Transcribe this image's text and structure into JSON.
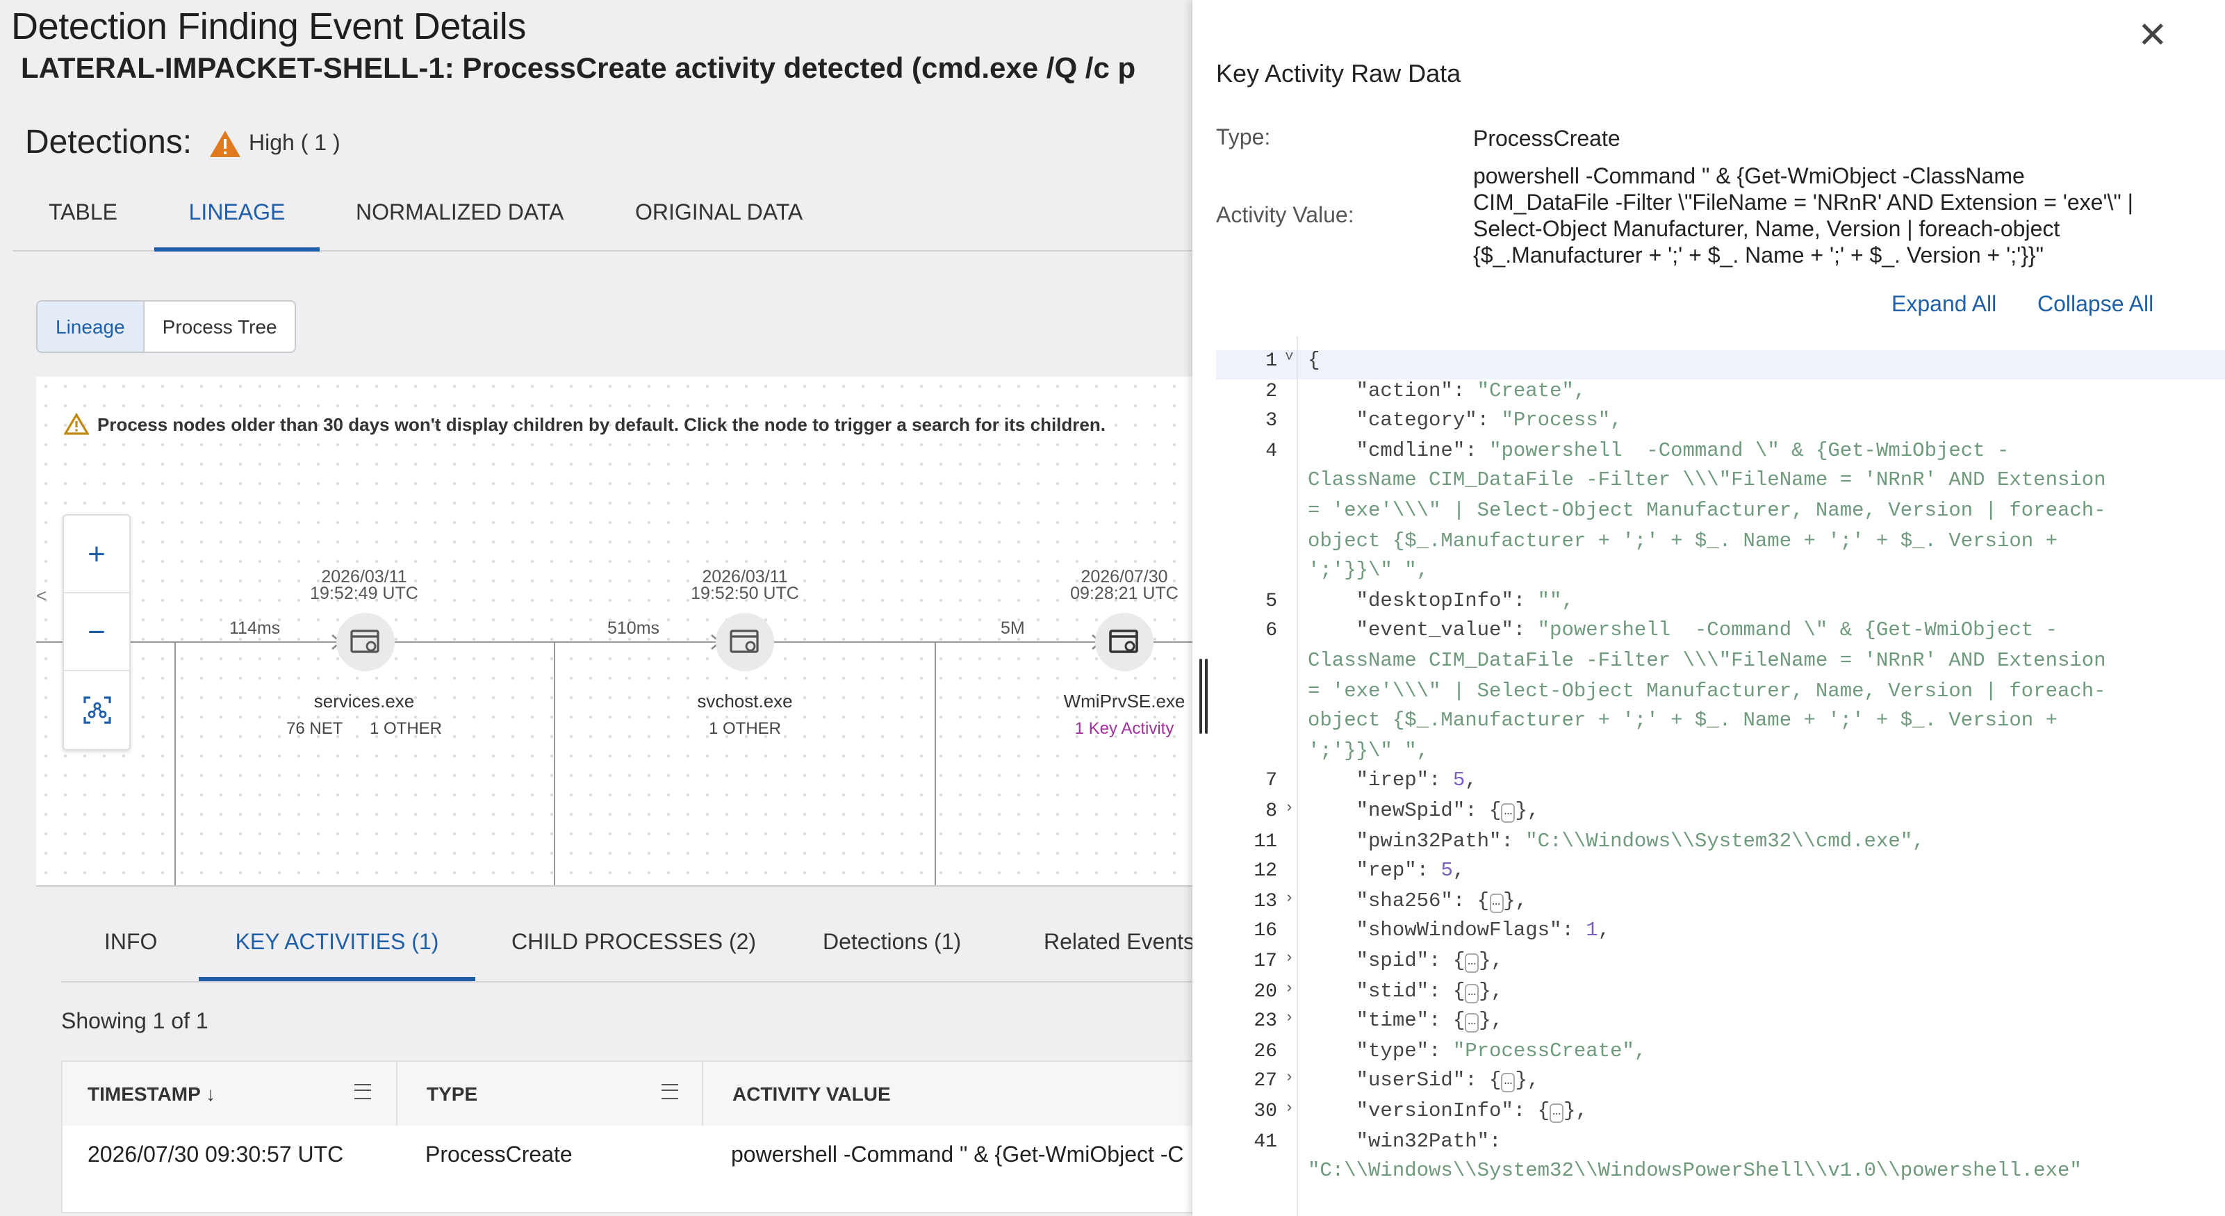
{
  "page": {
    "title": "Detection Finding Event Details",
    "finding_title": "LATERAL-IMPACKET-SHELL-1: ProcessCreate activity detected (cmd.exe /Q /c p",
    "detections_label": "Detections:",
    "severity": "High ( 1 )"
  },
  "tabs": [
    "TABLE",
    "LINEAGE",
    "NORMALIZED DATA",
    "ORIGINAL DATA"
  ],
  "view_toggle": [
    "Lineage",
    "Process Tree"
  ],
  "graph": {
    "warning": "Process nodes older than 30 days won't display children by default. Click the node to trigger a search for its children.",
    "zoom": {
      "in": "+",
      "out": "−"
    },
    "nodes": [
      {
        "date": "2026/03/11",
        "time": "19:52:49 UTC",
        "name": "services.exe",
        "sub1": "76 NET",
        "sub2": "1 OTHER",
        "edge": "114ms"
      },
      {
        "date": "2026/03/11",
        "time": "19:52:50 UTC",
        "name": "svchost.exe",
        "sub1": "1 OTHER",
        "sub2": "",
        "edge": "510ms"
      },
      {
        "date": "2026/07/30",
        "time": "09:28:21 UTC",
        "name": "WmiPrvSE.exe",
        "sub1": "1 Key Activity",
        "sub2": "",
        "edge": "5M"
      }
    ]
  },
  "bottom_tabs": [
    "INFO",
    "KEY ACTIVITIES (1)",
    "CHILD PROCESSES (2)",
    "Detections (1)",
    "Related Events"
  ],
  "showing": "Showing 1 of 1",
  "table": {
    "headers": [
      "TIMESTAMP",
      "TYPE",
      "ACTIVITY VALUE"
    ],
    "row": {
      "timestamp": "2026/07/30 09:30:57 UTC",
      "type": "ProcessCreate",
      "activity": "powershell -Command \" & {Get-WmiObject -C"
    }
  },
  "panel": {
    "title": "Key Activity Raw Data",
    "close": "✕",
    "type_label": "Type:",
    "type_value": "ProcessCreate",
    "activity_label": "Activity Value:",
    "activity_lines": [
      "powershell -Command \" & {Get-WmiObject -ClassName",
      "CIM_DataFile -Filter \\\"FileName = 'NRnR' AND Extension = 'exe'\\\" |",
      "Select-Object Manufacturer, Name, Version | foreach-object",
      "{$_.Manufacturer + ';' + $_. Name + ';' + $_. Version + ';'}}\""
    ],
    "expand_all": "Expand All",
    "collapse_all": "Collapse All"
  },
  "json_lines": [
    {
      "n": "1",
      "a": "˅",
      "t": "{"
    },
    {
      "n": "2",
      "a": "",
      "t": "    \"action\": \"Create\","
    },
    {
      "n": "3",
      "a": "",
      "t": "    \"category\": \"Process\","
    },
    {
      "n": "4",
      "a": "",
      "t": "    \"cmdline\": \"powershell  -Command \\\" & {Get-WmiObject -"
    },
    {
      "n": "",
      "a": "",
      "t": "ClassName CIM_DataFile -Filter \\\\\\\"FileName = 'NRnR' AND Extension"
    },
    {
      "n": "",
      "a": "",
      "t": "= 'exe'\\\\\\\" | Select-Object Manufacturer, Name, Version | foreach-"
    },
    {
      "n": "",
      "a": "",
      "t": "object {$_.Manufacturer + ';' + $_. Name + ';' + $_. Version +"
    },
    {
      "n": "",
      "a": "",
      "t": "';'}}\\\" \","
    },
    {
      "n": "5",
      "a": "",
      "t": "    \"desktopInfo\": \"\","
    },
    {
      "n": "6",
      "a": "",
      "t": "    \"event_value\": \"powershell  -Command \\\" & {Get-WmiObject -"
    },
    {
      "n": "",
      "a": "",
      "t": "ClassName CIM_DataFile -Filter \\\\\\\"FileName = 'NRnR' AND Extension"
    },
    {
      "n": "",
      "a": "",
      "t": "= 'exe'\\\\\\\" | Select-Object Manufacturer, Name, Version | foreach-"
    },
    {
      "n": "",
      "a": "",
      "t": "object {$_.Manufacturer + ';' + $_. Name + ';' + $_. Version +"
    },
    {
      "n": "",
      "a": "",
      "t": "';'}}\\\" \","
    },
    {
      "n": "7",
      "a": "",
      "t": "    \"irep\": 5,"
    },
    {
      "n": "8",
      "a": "›",
      "t": "    \"newSpid\": {…},"
    },
    {
      "n": "11",
      "a": "",
      "t": "    \"pwin32Path\": \"C:\\\\Windows\\\\System32\\\\cmd.exe\","
    },
    {
      "n": "12",
      "a": "",
      "t": "    \"rep\": 5,"
    },
    {
      "n": "13",
      "a": "›",
      "t": "    \"sha256\": {…},"
    },
    {
      "n": "16",
      "a": "",
      "t": "    \"showWindowFlags\": 1,"
    },
    {
      "n": "17",
      "a": "›",
      "t": "    \"spid\": {…},"
    },
    {
      "n": "20",
      "a": "›",
      "t": "    \"stid\": {…},"
    },
    {
      "n": "23",
      "a": "›",
      "t": "    \"time\": {…},"
    },
    {
      "n": "26",
      "a": "",
      "t": "    \"type\": \"ProcessCreate\","
    },
    {
      "n": "27",
      "a": "›",
      "t": "    \"userSid\": {…},"
    },
    {
      "n": "30",
      "a": "›",
      "t": "    \"versionInfo\": {…},"
    },
    {
      "n": "41",
      "a": "",
      "t": "    \"win32Path\":"
    },
    {
      "n": "",
      "a": "",
      "t": "\"C:\\\\Windows\\\\System32\\\\WindowsPowerShell\\\\v1.0\\\\powershell.exe\""
    }
  ]
}
